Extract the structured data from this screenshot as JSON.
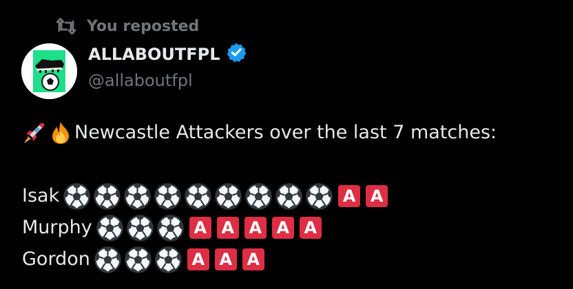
{
  "repost": {
    "label": "You reposted",
    "icon": "repost-icon"
  },
  "author": {
    "display_name": "ALLABOUTFPL",
    "handle": "@allaboutfpl",
    "verified": true,
    "verified_badge_color": "#1d9bf0",
    "avatar_icon": "boot-and-ball-logo"
  },
  "post": {
    "lead_emojis": [
      "rocket-emoji",
      "fire-emoji"
    ],
    "headline": "Newcastle Attackers over the last 7 matches:",
    "goal_icon": "soccer-ball-emoji",
    "assist_letter": "A",
    "assist_color": "#dd2e44",
    "players": [
      {
        "name": "Isak",
        "goals": 9,
        "assists": 2
      },
      {
        "name": "Murphy",
        "goals": 3,
        "assists": 5
      },
      {
        "name": "Gordon",
        "goals": 3,
        "assists": 3
      }
    ]
  },
  "colors": {
    "background": "#000000",
    "primary_text": "#e7e9ea",
    "secondary_text": "#71767b"
  }
}
